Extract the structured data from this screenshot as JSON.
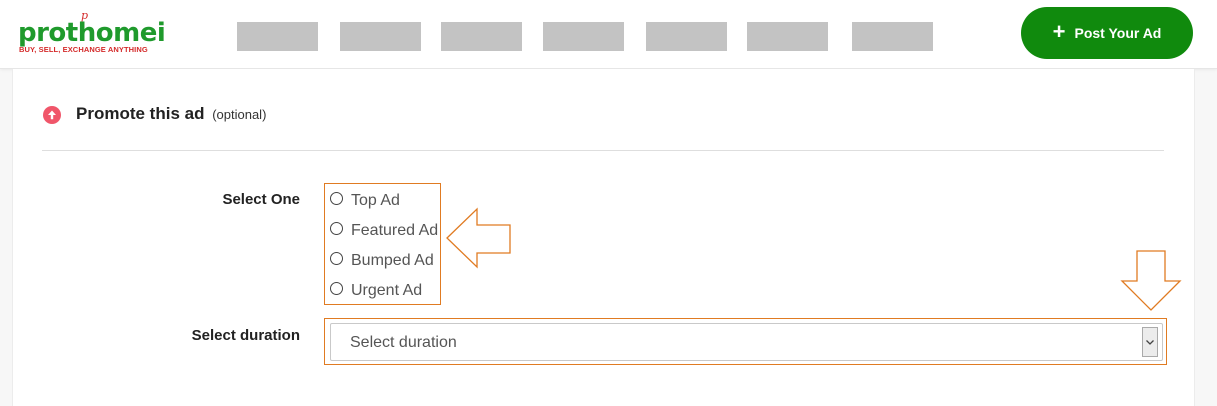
{
  "header": {
    "logo": {
      "name": "prothomei",
      "mark": "p",
      "tagline": "BUY, SELL, EXCHANGE ANYTHING",
      "brand_color": "#1f9a2c",
      "accent_color": "#d42a2a"
    },
    "nav_placeholders": 7,
    "post_button": {
      "label": "Post Your Ad",
      "icon": "plus-icon",
      "color": "#108a0d"
    }
  },
  "promote": {
    "icon": "arrow-up-circle-icon",
    "title": "Promote this ad",
    "optional": "(optional)",
    "select_one": {
      "label": "Select One",
      "options": [
        "Top Ad",
        "Featured Ad",
        "Bumped Ad",
        "Urgent Ad"
      ],
      "selected": null
    },
    "duration": {
      "label": "Select duration",
      "placeholder": "Select duration"
    }
  },
  "annotations": {
    "highlight_color": "#e07b22"
  }
}
